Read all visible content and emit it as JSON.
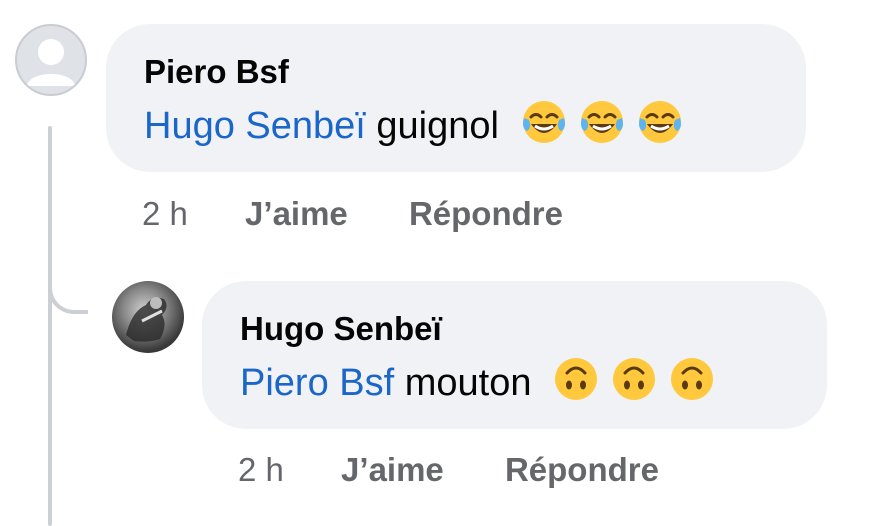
{
  "comments": [
    {
      "author": "Piero Bsf",
      "mention": "Hugo Senbeï",
      "text": "guignol",
      "emoji": "face-with-tears-of-joy",
      "emoji_count": 3,
      "time": "2 h",
      "like_label": "J’aime",
      "reply_label": "Répondre"
    },
    {
      "author": "Hugo Senbeï",
      "mention": "Piero Bsf",
      "text": "mouton",
      "emoji": "upside-down-face",
      "emoji_count": 3,
      "time": "2 h",
      "like_label": "J’aime",
      "reply_label": "Répondre"
    }
  ],
  "colors": {
    "mention": "#1b66c9",
    "bubble": "#f0f2f5",
    "secondary_text": "#65676b",
    "thread_line": "#ccd0d5"
  }
}
